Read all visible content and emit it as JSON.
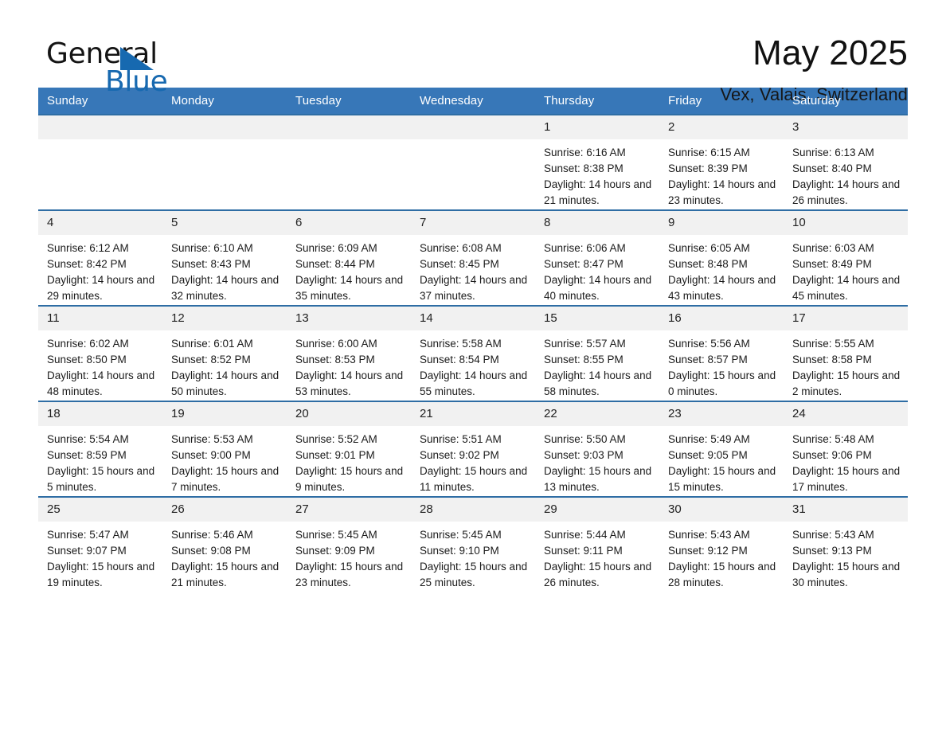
{
  "brand": {
    "word1": "General",
    "word2": "Blue",
    "triangle_color": "#1769b0",
    "icon": "triangle-logo-icon"
  },
  "header": {
    "month_title": "May 2025",
    "location": "Vex, Valais, Switzerland"
  },
  "theme": {
    "header_blue": "#3777b8",
    "row_rule_blue": "#2e6da4",
    "daynum_band": "#f1f1f1"
  },
  "calendar": {
    "weekday_headers": [
      "Sunday",
      "Monday",
      "Tuesday",
      "Wednesday",
      "Thursday",
      "Friday",
      "Saturday"
    ],
    "weeks": [
      [
        {
          "day": "",
          "sunrise": "",
          "sunset": "",
          "daylight": "",
          "blank": true
        },
        {
          "day": "",
          "sunrise": "",
          "sunset": "",
          "daylight": "",
          "blank": true
        },
        {
          "day": "",
          "sunrise": "",
          "sunset": "",
          "daylight": "",
          "blank": true
        },
        {
          "day": "",
          "sunrise": "",
          "sunset": "",
          "daylight": "",
          "blank": true
        },
        {
          "day": "1",
          "sunrise": "Sunrise: 6:16 AM",
          "sunset": "Sunset: 8:38 PM",
          "daylight": "Daylight: 14 hours and 21 minutes."
        },
        {
          "day": "2",
          "sunrise": "Sunrise: 6:15 AM",
          "sunset": "Sunset: 8:39 PM",
          "daylight": "Daylight: 14 hours and 23 minutes."
        },
        {
          "day": "3",
          "sunrise": "Sunrise: 6:13 AM",
          "sunset": "Sunset: 8:40 PM",
          "daylight": "Daylight: 14 hours and 26 minutes."
        }
      ],
      [
        {
          "day": "4",
          "sunrise": "Sunrise: 6:12 AM",
          "sunset": "Sunset: 8:42 PM",
          "daylight": "Daylight: 14 hours and 29 minutes."
        },
        {
          "day": "5",
          "sunrise": "Sunrise: 6:10 AM",
          "sunset": "Sunset: 8:43 PM",
          "daylight": "Daylight: 14 hours and 32 minutes."
        },
        {
          "day": "6",
          "sunrise": "Sunrise: 6:09 AM",
          "sunset": "Sunset: 8:44 PM",
          "daylight": "Daylight: 14 hours and 35 minutes."
        },
        {
          "day": "7",
          "sunrise": "Sunrise: 6:08 AM",
          "sunset": "Sunset: 8:45 PM",
          "daylight": "Daylight: 14 hours and 37 minutes."
        },
        {
          "day": "8",
          "sunrise": "Sunrise: 6:06 AM",
          "sunset": "Sunset: 8:47 PM",
          "daylight": "Daylight: 14 hours and 40 minutes."
        },
        {
          "day": "9",
          "sunrise": "Sunrise: 6:05 AM",
          "sunset": "Sunset: 8:48 PM",
          "daylight": "Daylight: 14 hours and 43 minutes."
        },
        {
          "day": "10",
          "sunrise": "Sunrise: 6:03 AM",
          "sunset": "Sunset: 8:49 PM",
          "daylight": "Daylight: 14 hours and 45 minutes."
        }
      ],
      [
        {
          "day": "11",
          "sunrise": "Sunrise: 6:02 AM",
          "sunset": "Sunset: 8:50 PM",
          "daylight": "Daylight: 14 hours and 48 minutes."
        },
        {
          "day": "12",
          "sunrise": "Sunrise: 6:01 AM",
          "sunset": "Sunset: 8:52 PM",
          "daylight": "Daylight: 14 hours and 50 minutes."
        },
        {
          "day": "13",
          "sunrise": "Sunrise: 6:00 AM",
          "sunset": "Sunset: 8:53 PM",
          "daylight": "Daylight: 14 hours and 53 minutes."
        },
        {
          "day": "14",
          "sunrise": "Sunrise: 5:58 AM",
          "sunset": "Sunset: 8:54 PM",
          "daylight": "Daylight: 14 hours and 55 minutes."
        },
        {
          "day": "15",
          "sunrise": "Sunrise: 5:57 AM",
          "sunset": "Sunset: 8:55 PM",
          "daylight": "Daylight: 14 hours and 58 minutes."
        },
        {
          "day": "16",
          "sunrise": "Sunrise: 5:56 AM",
          "sunset": "Sunset: 8:57 PM",
          "daylight": "Daylight: 15 hours and 0 minutes."
        },
        {
          "day": "17",
          "sunrise": "Sunrise: 5:55 AM",
          "sunset": "Sunset: 8:58 PM",
          "daylight": "Daylight: 15 hours and 2 minutes."
        }
      ],
      [
        {
          "day": "18",
          "sunrise": "Sunrise: 5:54 AM",
          "sunset": "Sunset: 8:59 PM",
          "daylight": "Daylight: 15 hours and 5 minutes."
        },
        {
          "day": "19",
          "sunrise": "Sunrise: 5:53 AM",
          "sunset": "Sunset: 9:00 PM",
          "daylight": "Daylight: 15 hours and 7 minutes."
        },
        {
          "day": "20",
          "sunrise": "Sunrise: 5:52 AM",
          "sunset": "Sunset: 9:01 PM",
          "daylight": "Daylight: 15 hours and 9 minutes."
        },
        {
          "day": "21",
          "sunrise": "Sunrise: 5:51 AM",
          "sunset": "Sunset: 9:02 PM",
          "daylight": "Daylight: 15 hours and 11 minutes."
        },
        {
          "day": "22",
          "sunrise": "Sunrise: 5:50 AM",
          "sunset": "Sunset: 9:03 PM",
          "daylight": "Daylight: 15 hours and 13 minutes."
        },
        {
          "day": "23",
          "sunrise": "Sunrise: 5:49 AM",
          "sunset": "Sunset: 9:05 PM",
          "daylight": "Daylight: 15 hours and 15 minutes."
        },
        {
          "day": "24",
          "sunrise": "Sunrise: 5:48 AM",
          "sunset": "Sunset: 9:06 PM",
          "daylight": "Daylight: 15 hours and 17 minutes."
        }
      ],
      [
        {
          "day": "25",
          "sunrise": "Sunrise: 5:47 AM",
          "sunset": "Sunset: 9:07 PM",
          "daylight": "Daylight: 15 hours and 19 minutes."
        },
        {
          "day": "26",
          "sunrise": "Sunrise: 5:46 AM",
          "sunset": "Sunset: 9:08 PM",
          "daylight": "Daylight: 15 hours and 21 minutes."
        },
        {
          "day": "27",
          "sunrise": "Sunrise: 5:45 AM",
          "sunset": "Sunset: 9:09 PM",
          "daylight": "Daylight: 15 hours and 23 minutes."
        },
        {
          "day": "28",
          "sunrise": "Sunrise: 5:45 AM",
          "sunset": "Sunset: 9:10 PM",
          "daylight": "Daylight: 15 hours and 25 minutes."
        },
        {
          "day": "29",
          "sunrise": "Sunrise: 5:44 AM",
          "sunset": "Sunset: 9:11 PM",
          "daylight": "Daylight: 15 hours and 26 minutes."
        },
        {
          "day": "30",
          "sunrise": "Sunrise: 5:43 AM",
          "sunset": "Sunset: 9:12 PM",
          "daylight": "Daylight: 15 hours and 28 minutes."
        },
        {
          "day": "31",
          "sunrise": "Sunrise: 5:43 AM",
          "sunset": "Sunset: 9:13 PM",
          "daylight": "Daylight: 15 hours and 30 minutes."
        }
      ]
    ]
  }
}
